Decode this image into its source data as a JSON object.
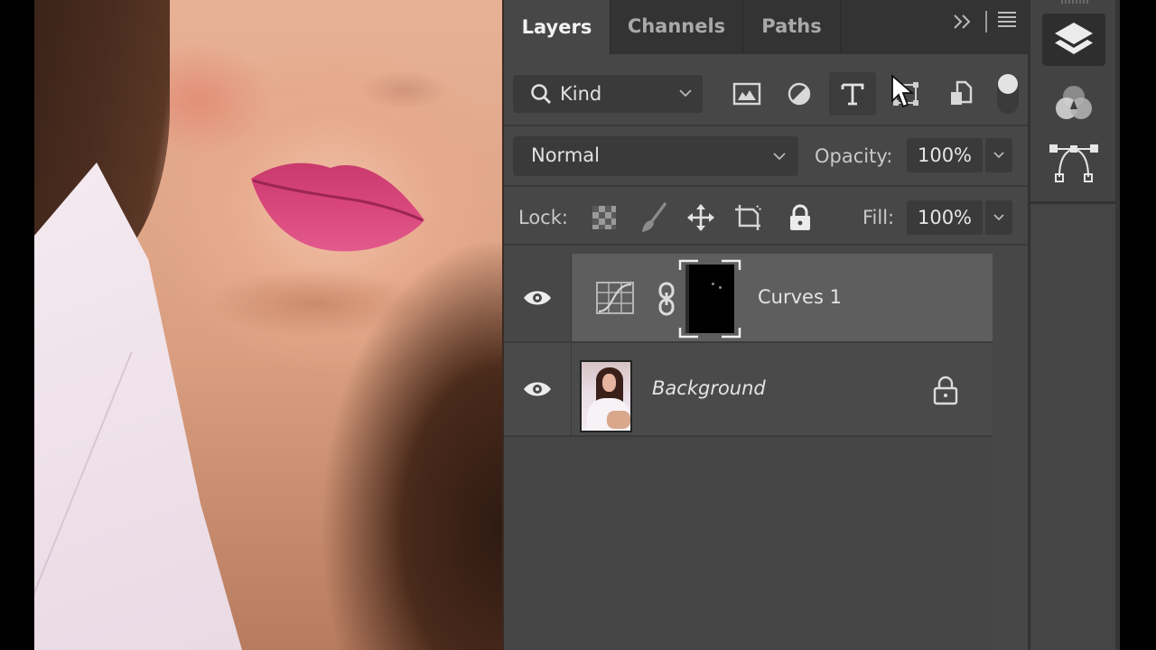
{
  "canvas": {
    "image_description": "Close-up portrait: woman's lower face with pink lips, dark hair, white shirt collar"
  },
  "panel": {
    "tabs": [
      {
        "label": "Layers",
        "active": true
      },
      {
        "label": "Channels",
        "active": false
      },
      {
        "label": "Paths",
        "active": false
      }
    ],
    "more_icon": "double-chevron-right-icon",
    "menu_icon": "hamburger-menu-icon"
  },
  "filter": {
    "kind_label": "Kind",
    "kind_icon": "search-icon",
    "buttons": [
      {
        "name": "pixel-layer-filter",
        "icon": "image-icon"
      },
      {
        "name": "adjustment-layer-filter",
        "icon": "half-circle-icon"
      },
      {
        "name": "type-layer-filter",
        "icon": "type-icon",
        "selected": true
      },
      {
        "name": "shape-layer-filter",
        "icon": "shape-icon"
      },
      {
        "name": "smart-object-filter",
        "icon": "smart-object-icon"
      }
    ],
    "toggle_on": true
  },
  "blend": {
    "mode": "Normal",
    "opacity_label": "Opacity:",
    "opacity_value": "100%"
  },
  "lock": {
    "label": "Lock:",
    "icons": [
      "transparent-pixels-lock-icon",
      "image-pixels-lock-icon",
      "position-lock-icon",
      "artboard-lock-icon",
      "lock-all-icon"
    ],
    "fill_label": "Fill:",
    "fill_value": "100%"
  },
  "layers": [
    {
      "name": "Curves 1",
      "type": "adjustment-curves",
      "visible": true,
      "selected": true,
      "has_mask": true,
      "linked": true
    },
    {
      "name": "Background",
      "type": "pixel",
      "visible": true,
      "selected": false,
      "locked": true
    }
  ],
  "dock": {
    "buttons": [
      {
        "name": "layers",
        "icon": "layers-stack-icon",
        "active": true
      },
      {
        "name": "channels",
        "icon": "channels-rgb-icon",
        "active": false
      },
      {
        "name": "paths",
        "icon": "bezier-path-icon",
        "active": false
      }
    ]
  },
  "colors": {
    "panel_bg": "#484748",
    "tab_bar_bg": "#343334",
    "selected_layer_bg": "#5f5e5f",
    "lip_color": "#d9487e"
  }
}
